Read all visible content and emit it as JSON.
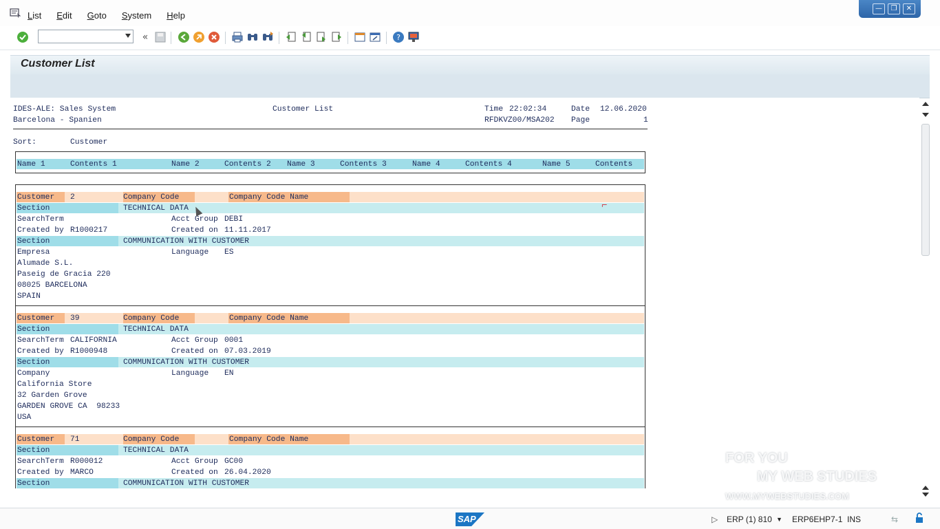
{
  "menu": {
    "items": [
      "List",
      "Edit",
      "Goto",
      "System",
      "Help"
    ]
  },
  "window_controls": [
    "—",
    "❐",
    "✕"
  ],
  "toolbar": {
    "icons": [
      "check-icon",
      "back-double-icon",
      "save-icon",
      "back-icon",
      "exit-icon",
      "cancel-icon",
      "print-icon",
      "find-icon",
      "find-next-icon",
      "first-page-icon",
      "prev-page-icon",
      "next-page-icon",
      "last-page-icon",
      "create-session-icon",
      "shortcut-icon",
      "help-icon",
      "customize-layout-icon"
    ]
  },
  "title": "Customer List",
  "report_header": {
    "system": "IDES-ALE: Sales System",
    "location": "Barcelona - Spanien",
    "center_title": "Customer List",
    "time_label": "Time",
    "time": "22:02:34",
    "date_label": "Date",
    "date": "12.06.2020",
    "program": "RFDKVZ00/MSA202",
    "page_label": "Page",
    "page": "1",
    "sort_label": "Sort:",
    "sort_value": "Customer"
  },
  "columns": [
    "Name 1",
    "Contents 1",
    "Name 2",
    "Contents 2",
    "Name 3",
    "Contents 3",
    "Name 4",
    "Contents 4",
    "Name 5",
    "Contents"
  ],
  "labels": {
    "customer": "Customer",
    "company_code": "Company Code",
    "company_code_name": "Company Code Name",
    "section": "Section",
    "technical_data": "TECHNICAL DATA",
    "communication": "COMMUNICATION WITH CUSTOMER",
    "search_term": "SearchTerm",
    "acct_group": "Acct Group",
    "created_by": "Created by",
    "created_on": "Created on",
    "language": "Language"
  },
  "customers": [
    {
      "number": "2",
      "search_term": "",
      "acct_group": "DEBI",
      "created_by": "R1000217",
      "created_on": "11.11.2017",
      "title": "Empresa",
      "language": "ES",
      "address": [
        "Alumade S.L.",
        "Paseig de Gracia 220",
        "08025 BARCELONA",
        "SPAIN"
      ]
    },
    {
      "number": "39",
      "search_term": "CALIFORNIA",
      "acct_group": "0001",
      "created_by": "R1000948",
      "created_on": "07.03.2019",
      "title": "Company",
      "language": "EN",
      "address": [
        "California Store",
        "32 Garden Grove",
        "GARDEN GROVE CA  98233",
        "USA"
      ]
    },
    {
      "number": "71",
      "search_term": "R000012",
      "acct_group": "GC00",
      "created_by": "MARCO",
      "created_on": "26.04.2020"
    }
  ],
  "status": {
    "sap_logo": "SAP",
    "system": "ERP (1) 810",
    "server": "ERP6EHP7-1",
    "mode": "INS"
  },
  "watermark": {
    "line1": "FOR YOU",
    "line2": "MY WEB STUDIES",
    "line3": "WWW.MYWEBSTUDIES.COM"
  }
}
